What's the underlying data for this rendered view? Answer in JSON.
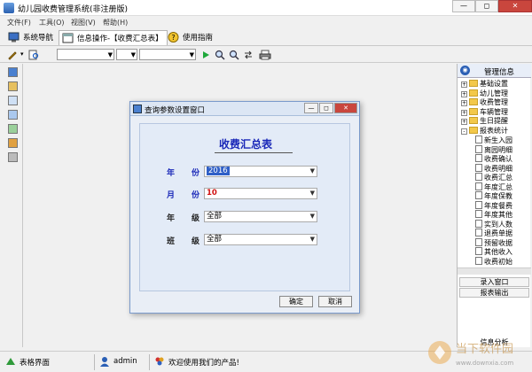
{
  "window": {
    "title": "幼儿园收费管理系统(非注册版)",
    "controls": [
      "—",
      "◻",
      "✕"
    ]
  },
  "menubar": {
    "items": [
      "文件(F)",
      "工具(O)",
      "视图(V)",
      "帮助(H)"
    ]
  },
  "tabs": [
    {
      "label": "系统导航",
      "icon": "monitor-icon"
    },
    {
      "label": "信息操作-【收费汇总表】",
      "icon": "window-icon"
    },
    {
      "label": "使用指南",
      "icon": "help-icon"
    }
  ],
  "toolbar": {
    "combo1_value": "",
    "combo2_value": "",
    "combo3_value": "",
    "icons": [
      "pencil-icon",
      "search-icon",
      "play-icon",
      "find-icon",
      "find-next-icon",
      "refresh-icon",
      "print-icon"
    ]
  },
  "leftbar": {
    "icons": [
      "record-icon",
      "edit-tool-icon",
      "grid-icon",
      "document-icon",
      "chart-icon",
      "users-icon",
      "trash-icon"
    ]
  },
  "right_panel": {
    "header": "管理信息",
    "tree": [
      {
        "label": "基础设置",
        "level": 0,
        "type": "folder",
        "toggle": "+"
      },
      {
        "label": "幼儿管理",
        "level": 0,
        "type": "folder",
        "toggle": "+"
      },
      {
        "label": "收费管理",
        "level": 0,
        "type": "folder",
        "toggle": "+"
      },
      {
        "label": "车辆管理",
        "level": 0,
        "type": "folder",
        "toggle": "+"
      },
      {
        "label": "生日提醒",
        "level": 0,
        "type": "folder",
        "toggle": "+"
      },
      {
        "label": "报表统计",
        "level": 0,
        "type": "folder",
        "toggle": "-"
      },
      {
        "label": "新生入园",
        "level": 1,
        "type": "doc"
      },
      {
        "label": "离园明细",
        "level": 1,
        "type": "doc"
      },
      {
        "label": "收费确认",
        "level": 1,
        "type": "doc"
      },
      {
        "label": "收费明细",
        "level": 1,
        "type": "doc"
      },
      {
        "label": "收费汇总",
        "level": 1,
        "type": "doc"
      },
      {
        "label": "年度汇总",
        "level": 1,
        "type": "doc"
      },
      {
        "label": "年度保教",
        "level": 1,
        "type": "doc"
      },
      {
        "label": "年度餐费",
        "level": 1,
        "type": "doc"
      },
      {
        "label": "年度其他",
        "level": 1,
        "type": "doc"
      },
      {
        "label": "实到人数",
        "level": 1,
        "type": "doc"
      },
      {
        "label": "退费单据",
        "level": 1,
        "type": "doc"
      },
      {
        "label": "预留收据",
        "level": 1,
        "type": "doc"
      },
      {
        "label": "其他收入",
        "level": 1,
        "type": "doc"
      },
      {
        "label": "收费初始",
        "level": 1,
        "type": "doc"
      }
    ],
    "buttons": [
      "录入窗口",
      "报表输出"
    ],
    "footer": "信息分析"
  },
  "dialog": {
    "title": "查询参数设置窗口",
    "heading": "收费汇总表",
    "fields": [
      {
        "label_a": "年",
        "label_b": "份",
        "value": "2016",
        "style": "selected"
      },
      {
        "label_a": "月",
        "label_b": "份",
        "value": "10",
        "style": "red"
      },
      {
        "label_a": "年",
        "label_b": "级",
        "value": "全部",
        "style": "normal"
      },
      {
        "label_a": "班",
        "label_b": "级",
        "value": "全部",
        "style": "normal"
      }
    ],
    "ok_label": "确定",
    "cancel_label": "取消"
  },
  "statusbar": {
    "view_label": "表格界面",
    "user": "admin",
    "message": "欢迎使用我们的产品!"
  },
  "watermark": {
    "text": "当下软件园",
    "subtext": "www.downxia.com"
  }
}
